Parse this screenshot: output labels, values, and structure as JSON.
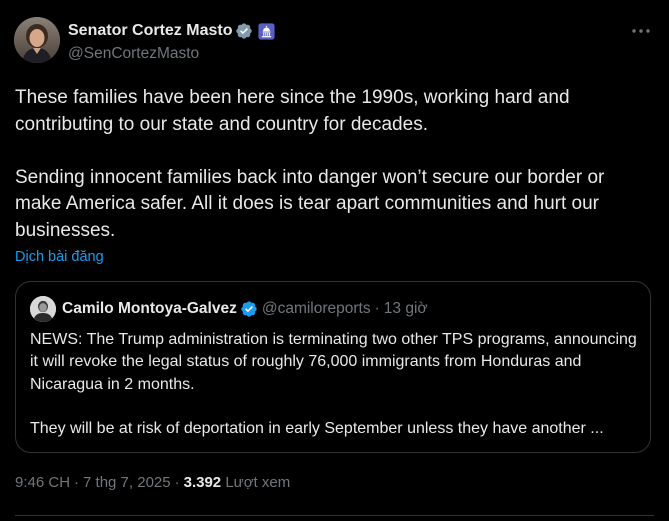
{
  "author": {
    "display_name": "Senator Cortez Masto",
    "handle": "@SenCortezMasto",
    "verified_icon": "verified-badge-icon",
    "affiliation_icon": "government-badge-icon"
  },
  "tweet": {
    "paragraph_1": "These families have been here since the 1990s, working hard and contributing to our state and country for decades.",
    "paragraph_2": "Sending innocent families back into danger won’t secure our border or make America safer. All it does is tear apart communities and hurt our businesses.",
    "translate_link": "Dịch bài đăng"
  },
  "quoted_tweet": {
    "display_name": "Camilo Montoya-Galvez",
    "handle": "@camiloreports",
    "separator": "·",
    "time_ago": "13 giờ",
    "paragraph_1": "NEWS: The Trump administration is terminating two other TPS programs, announcing it will revoke the legal status of roughly 76,000 immigrants from Honduras and Nicaragua in 2 months.",
    "paragraph_2": "They will be at risk of deportation in early September unless they have another ..."
  },
  "meta": {
    "time": "9:46 CH",
    "separator": "·",
    "date": "7 thg 7, 2025",
    "views_count": "3.392",
    "views_label": "Lượt xem"
  },
  "colors": {
    "background": "#000000",
    "text_primary": "#e7e9ea",
    "text_secondary": "#71767b",
    "link": "#1d9bf0",
    "border": "#2f3336"
  }
}
